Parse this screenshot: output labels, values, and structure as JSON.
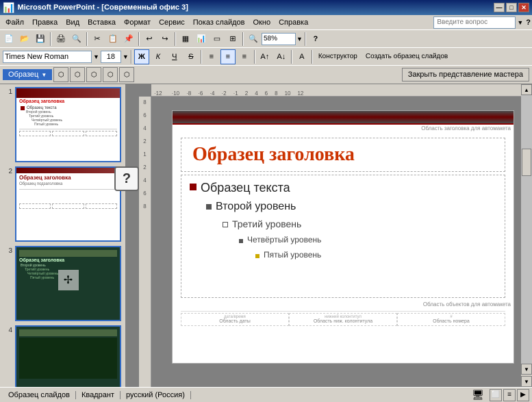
{
  "window": {
    "title": "Microsoft PowerPoint - [Современный офис 3]",
    "icon": "📊"
  },
  "titlebar": {
    "title": "Microsoft PowerPoint - [Современный офис 3]",
    "min": "—",
    "max": "□",
    "close": "✕"
  },
  "menubar": {
    "items": [
      "Файл",
      "Правка",
      "Вид",
      "Вставка",
      "Формат",
      "Сервис",
      "Показ слайдов",
      "Окно",
      "Справка"
    ],
    "search_placeholder": "Введите вопрос"
  },
  "formatbar": {
    "font_name": "Times New Roman",
    "font_size": "18",
    "bold": "Ж",
    "italic": "К",
    "underline": "Ч",
    "strikethrough": "S",
    "align_left": "≡",
    "align_center": "≡",
    "align_right": "≡",
    "constructor_label": "Конструктор",
    "create_sample_label": "Создать образец слайдов"
  },
  "master_toolbar": {
    "label": "Образец",
    "close_btn": "Закрыть представление мастера"
  },
  "ruler": {
    "ticks": [
      "-12",
      "-10",
      "-8",
      "-6",
      "-4",
      "-2",
      "1",
      "2",
      "4",
      "6",
      "8",
      "10",
      "12"
    ]
  },
  "slides": [
    {
      "num": "1",
      "type": "light",
      "title": "Образец заголовка",
      "subtitle": "Образец текста",
      "items": [
        "Второй уровень",
        "Третий уровень",
        "Четвёртый уровень",
        "Пятый уровень"
      ]
    },
    {
      "num": "2",
      "type": "light",
      "title": "Образец заголовка",
      "subtitle": "Образец подзаголовка"
    },
    {
      "num": "3",
      "type": "dark",
      "title": "Образец заголовка",
      "items": [
        "Второй уровень",
        "Третий уровень",
        "Четвёртый уровень",
        "Пятый уровень"
      ]
    },
    {
      "num": "4",
      "type": "dark",
      "title": ""
    }
  ],
  "editor": {
    "title_hint": "Область заголовка для автомакета",
    "objects_hint": "Область объектов для автомакета",
    "title": "Образец заголовка",
    "content": {
      "l1": "Образец текста",
      "l2": "Второй уровень",
      "l3": "Третий уровень",
      "l4": "Четвёртый уровень",
      "l5": "Пятый уровень"
    },
    "footer": {
      "date_label": "Область даты",
      "date_field": "дата/время",
      "footer_label": "Область ниж. колонтитула",
      "footer_field": "нижний колонтитул",
      "num_label": "Область номера",
      "num_field": "#"
    }
  },
  "statusbar": {
    "slide_info": "Образец слайдов",
    "position": "Квадрант",
    "language": "русский (Россия)"
  },
  "zoom": {
    "value": "58%"
  }
}
